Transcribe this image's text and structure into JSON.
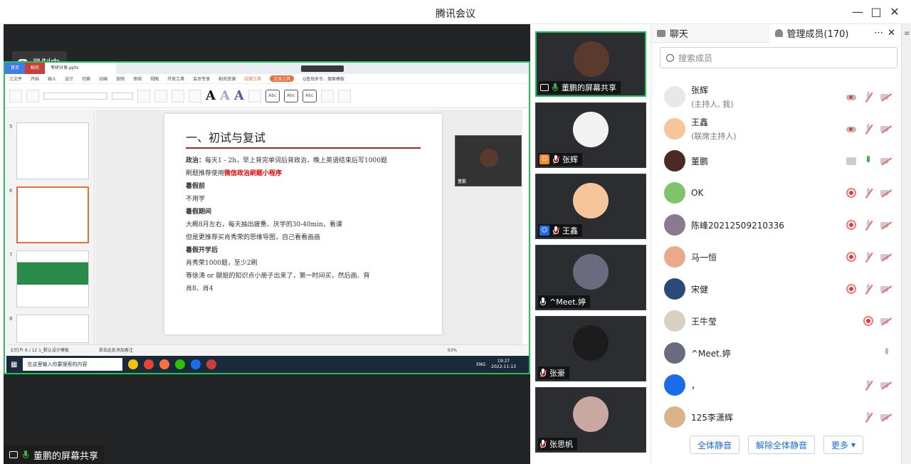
{
  "window": {
    "title": "腾讯会议"
  },
  "stage": {
    "recording_label": "录制中",
    "sharer_label": "董鹏的屏幕共享"
  },
  "shared_screen": {
    "wps_tabs": [
      "首页",
      "稻壳",
      "考研分享.pptx"
    ],
    "menu": [
      "三文件",
      "开始",
      "插入",
      "设计",
      "切换",
      "动画",
      "放映",
      "审阅",
      "视图",
      "开发工具",
      "会员专享",
      "稻壳资源",
      "绘图工具",
      "文本工具"
    ],
    "menu_search": "Q查找命令、搜索模板",
    "slide": {
      "title": "一、初试与复试",
      "lines": [
        {
          "parts": [
            {
              "t": "政治：",
              "cls": "b"
            },
            {
              "t": "每天1 - 2h，早上背完单词后背政治，晚上英语结束后写1000题",
              "cls": ""
            }
          ]
        },
        {
          "parts": [
            {
              "t": "刷题推荐使用",
              "cls": ""
            },
            {
              "t": "微信政治刷题小程序",
              "cls": "red"
            }
          ]
        },
        {
          "parts": [
            {
              "t": "暑假前",
              "cls": "b"
            }
          ]
        },
        {
          "parts": [
            {
              "t": "不用学",
              "cls": ""
            }
          ]
        },
        {
          "parts": [
            {
              "t": "暑假期间",
              "cls": "b"
            }
          ]
        },
        {
          "parts": [
            {
              "t": "大概8月左右，每天抽出疲惫、厌学的30-40min，看课",
              "cls": ""
            }
          ]
        },
        {
          "parts": [
            {
              "t": "但是更推荐买肖秀荣的思维导图，自己看看画画",
              "cls": ""
            }
          ]
        },
        {
          "parts": [
            {
              "t": "暑假开学后",
              "cls": "b"
            }
          ]
        },
        {
          "parts": [
            {
              "t": "肖秀荣1000题，至少2刷",
              "cls": ""
            }
          ]
        },
        {
          "parts": [
            {
              "t": "等徐涛 or 腿姐的知识点小册子出来了，第一时间买，然后画、背",
              "cls": ""
            }
          ]
        },
        {
          "parts": [
            {
              "t": "肖8、肖4",
              "cls": ""
            }
          ]
        }
      ]
    },
    "thumb_numbers": [
      "5",
      "6",
      "7",
      "8"
    ],
    "status_text": "幻灯片 6 / 12     1_默认设计模板",
    "notes_text": "单击此处添加备注",
    "zoom_text": "93%",
    "taskbar_search": "在这里输入你要搜索的内容",
    "clock": "19:27",
    "date": "2022-11-13",
    "lang": "ENG",
    "mini_cam_name": "董鹏"
  },
  "video_tiles": [
    {
      "name": "董鹏的屏幕共享",
      "mic": "on",
      "badge": "screen",
      "active": true,
      "avatar_color": "#5b3a2e"
    },
    {
      "name": "张辉",
      "mic": "off",
      "badge": "host",
      "active": false,
      "avatar_color": "#f2f2f2"
    },
    {
      "name": "王鑫",
      "mic": "off",
      "badge": "cohost",
      "active": false,
      "avatar_color": "#f6c69a"
    },
    {
      "name": "^Meet.婷",
      "mic": "on-white",
      "badge": "",
      "active": false,
      "avatar_color": "#6b6b80"
    },
    {
      "name": "张豪",
      "mic": "off",
      "badge": "",
      "active": false,
      "avatar_color": "#1c1c1c"
    },
    {
      "name": "张思帆",
      "mic": "off",
      "badge": "",
      "active": false,
      "avatar_color": "#c8a8a0"
    }
  ],
  "panel": {
    "tab_chat": "聊天",
    "tab_members": "管理成员(170)",
    "search_placeholder": "搜索成员",
    "members": [
      {
        "name": "张辉",
        "sub": "(主持人, 我)",
        "icons": [
          "cloud",
          "mic-off",
          "cam-off"
        ],
        "avatar_color": "#e8e8e8"
      },
      {
        "name": "王鑫",
        "sub": "(联席主持人)",
        "icons": [
          "cloud",
          "mic-off",
          "cam-off"
        ],
        "avatar_color": "#f6c69a"
      },
      {
        "name": "董鹏",
        "sub": "",
        "icons": [
          "screen",
          "mic-on",
          "cam-off"
        ],
        "avatar_color": "#4a2a22"
      },
      {
        "name": "OK",
        "sub": "",
        "icons": [
          "rec",
          "mic-off",
          "cam-off"
        ],
        "avatar_color": "#7fc46a"
      },
      {
        "name": "陈峰20212509210336",
        "sub": "",
        "icons": [
          "rec",
          "mic-off",
          "cam-off"
        ],
        "avatar_color": "#8a7a90"
      },
      {
        "name": "马一恒",
        "sub": "",
        "icons": [
          "rec",
          "mic-off",
          "cam-off"
        ],
        "avatar_color": "#e9a98a"
      },
      {
        "name": "宋健",
        "sub": "",
        "icons": [
          "rec",
          "mic-off",
          "cam-off"
        ],
        "avatar_color": "#2a4a7a"
      },
      {
        "name": "王牛莹",
        "sub": "",
        "icons": [
          "rec",
          "cam-off"
        ],
        "avatar_color": "#d8d0c0"
      },
      {
        "name": "^Meet.婷",
        "sub": "",
        "icons": [
          "mic-grey"
        ],
        "avatar_color": "#6b6b80"
      },
      {
        "name": "，",
        "sub": "",
        "icons": [
          "mic-off",
          "cam-off"
        ],
        "avatar_color": "#1a6ce8"
      },
      {
        "name": "125李潇辉",
        "sub": "",
        "icons": [
          "mic-off",
          "cam-off"
        ],
        "avatar_color": "#d9b48a"
      }
    ],
    "btn_mute_all": "全体静音",
    "btn_unmute_all": "解除全体静音",
    "btn_more": "更多"
  },
  "colors": {
    "accent": "#1a6ce8",
    "active_border": "#21c15a",
    "record_red": "#e33"
  }
}
